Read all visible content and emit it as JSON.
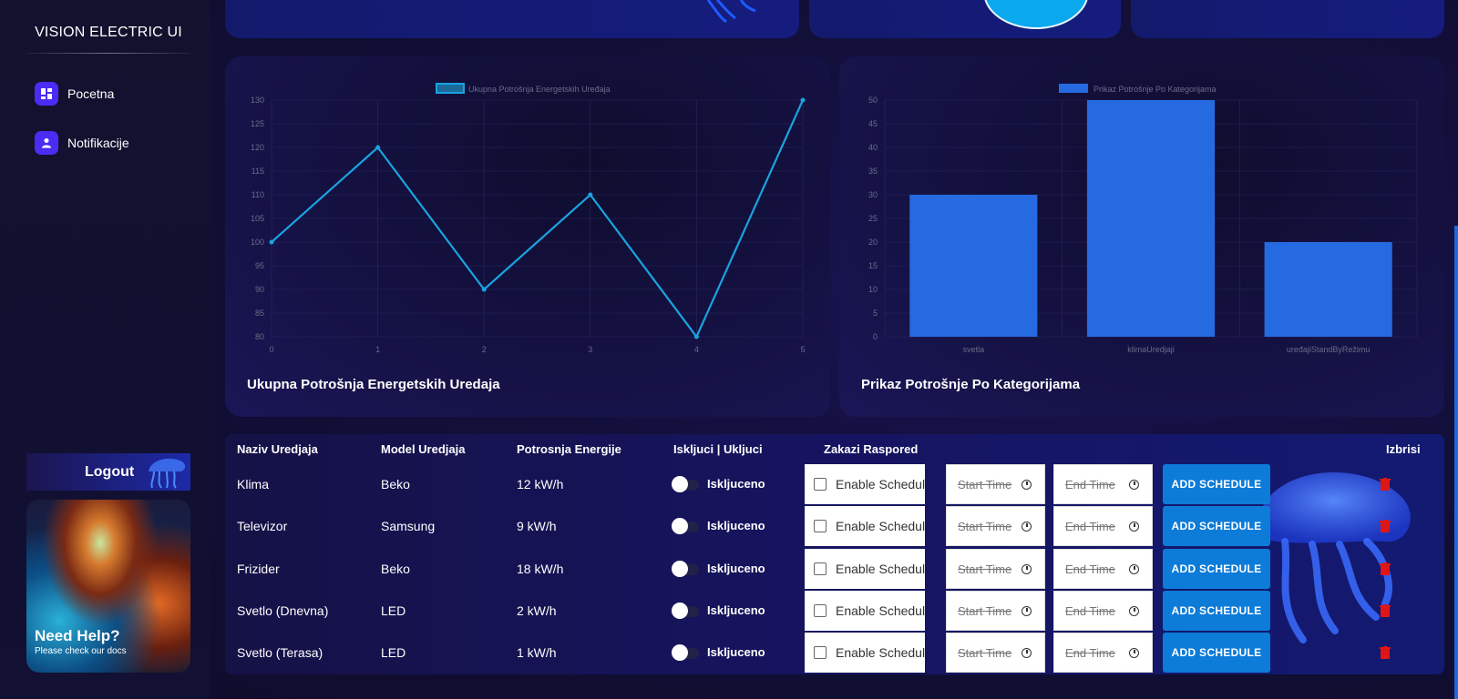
{
  "brand": "VISION ELECTRIC UI",
  "nav": [
    {
      "label": "Pocetna",
      "icon": "dashboard-icon"
    },
    {
      "label": "Notifikacije",
      "icon": "person-icon"
    }
  ],
  "logout_label": "Logout",
  "help": {
    "title": "Need Help?",
    "subtitle": "Please check our docs"
  },
  "line_chart": {
    "title": "Ukupna Potrošnja Energetskih Uredaja",
    "chart_data": {
      "type": "line",
      "x": [
        0,
        1,
        2,
        3,
        4,
        5
      ],
      "series": [
        {
          "name": "Ukupna Potrošnja Energetskih Uređaja",
          "values": [
            100,
            120,
            90,
            110,
            80,
            130
          ]
        }
      ],
      "ylim": [
        80,
        130
      ],
      "yticks": [
        80,
        85,
        90,
        95,
        100,
        105,
        110,
        115,
        120,
        125,
        130
      ],
      "legend": "top",
      "color": "#1aa3e0"
    }
  },
  "bar_chart": {
    "title": "Prikaz Potrošnje Po Kategorijama",
    "chart_data": {
      "type": "bar",
      "categories": [
        "svetla",
        "klimaUredjaji",
        "uređajiStandByRežimu"
      ],
      "series": [
        {
          "name": "Prikaz Potrošnje Po Kategorijama",
          "values": [
            30,
            50,
            20
          ]
        }
      ],
      "ylim": [
        0,
        50
      ],
      "yticks": [
        0,
        5,
        10,
        15,
        20,
        25,
        30,
        35,
        40,
        45,
        50
      ],
      "legend": "top",
      "color": "#256ae0"
    }
  },
  "table": {
    "headers": [
      "Naziv Uredjaja",
      "Model Uredjaja",
      "Potrosnja Energije",
      "Iskljuci | Ukljuci",
      "Zakazi Raspored",
      "Izbrisi"
    ],
    "rows": [
      {
        "name": "Klima",
        "model": "Beko",
        "power": "12 kW/h",
        "state": "Iskljuceno"
      },
      {
        "name": "Televizor",
        "model": "Samsung",
        "power": "9 kW/h",
        "state": "Iskljuceno"
      },
      {
        "name": "Frizider",
        "model": "Beko",
        "power": "18 kW/h",
        "state": "Iskljuceno"
      },
      {
        "name": "Svetlo (Dnevna)",
        "model": "LED",
        "power": "2 kW/h",
        "state": "Iskljuceno"
      },
      {
        "name": "Svetlo (Terasa)",
        "model": "LED",
        "power": "1 kW/h",
        "state": "Iskljuceno"
      }
    ],
    "enable_schedule_label": "Enable Schedule",
    "start_time_placeholder": "Start Time",
    "end_time_placeholder": "End Time",
    "add_schedule_label": "ADD SCHEDULE"
  }
}
